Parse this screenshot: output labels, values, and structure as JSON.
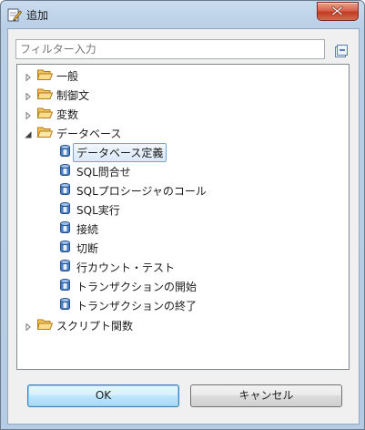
{
  "window": {
    "title": "追加"
  },
  "filter": {
    "placeholder": "フィルター入力"
  },
  "tree": {
    "folders": [
      {
        "label": "一般",
        "expanded": false
      },
      {
        "label": "制御文",
        "expanded": false
      },
      {
        "label": "変数",
        "expanded": false
      },
      {
        "label": "データベース",
        "expanded": true
      },
      {
        "label": "スクリプト関数",
        "expanded": false
      }
    ],
    "database_items": [
      {
        "label": "データベース定義",
        "selected": true
      },
      {
        "label": "SQL問合せ"
      },
      {
        "label": "SQLプロシージャのコール"
      },
      {
        "label": "SQL実行"
      },
      {
        "label": "接続"
      },
      {
        "label": "切断"
      },
      {
        "label": "行カウント・テスト"
      },
      {
        "label": "トランザクションの開始"
      },
      {
        "label": "トランザクションの終了"
      }
    ]
  },
  "buttons": {
    "ok": "OK",
    "cancel": "キャンセル"
  },
  "icons": {
    "app": "edit-add-icon",
    "close": "close-icon",
    "collapse_all": "collapse-all-icon",
    "folder": "folder-icon",
    "database": "database-icon"
  },
  "colors": {
    "title_bar": "#b9cfe6",
    "close_button": "#c23b22",
    "folder": "#e8b14a",
    "database_icon": "#3a6fb8",
    "selection_border": "#7da2ce",
    "default_button_border": "#3c7fb1"
  }
}
